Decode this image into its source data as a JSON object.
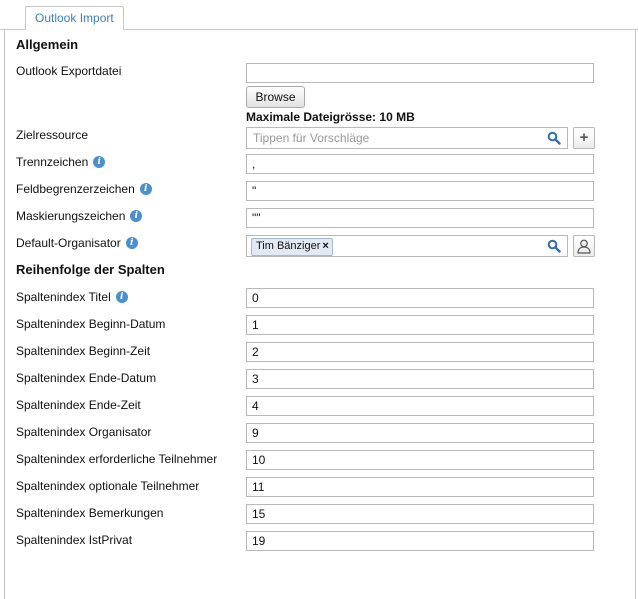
{
  "tab": {
    "label": "Outlook Import"
  },
  "sections": {
    "general": "Allgemein",
    "columns": "Reihenfolge der Spalten"
  },
  "export_file": {
    "label": "Outlook Exportdatei",
    "value": "",
    "browse_label": "Browse",
    "max_size_text": "Maximale Dateigrösse: 10 MB"
  },
  "target_resource": {
    "label": "Zielressource",
    "placeholder": "Tippen für Vorschläge",
    "add_label": "+"
  },
  "separator": {
    "label": "Trennzeichen",
    "value": ","
  },
  "field_delimiter": {
    "label": "Feldbegrenzerzeichen",
    "value": "\""
  },
  "escape_char": {
    "label": "Maskierungszeichen",
    "value": "\"\""
  },
  "default_organizer": {
    "label": "Default-Organisator",
    "chip": "Tim Bänziger",
    "chip_remove": "×"
  },
  "columns": [
    {
      "label": "Spaltenindex Titel",
      "value": "0"
    },
    {
      "label": "Spaltenindex Beginn-Datum",
      "value": "1"
    },
    {
      "label": "Spaltenindex Beginn-Zeit",
      "value": "2"
    },
    {
      "label": "Spaltenindex Ende-Datum",
      "value": "3"
    },
    {
      "label": "Spaltenindex Ende-Zeit",
      "value": "4"
    },
    {
      "label": "Spaltenindex Organisator",
      "value": "9"
    },
    {
      "label": "Spaltenindex erforderliche Teilnehmer",
      "value": "10"
    },
    {
      "label": "Spaltenindex optionale Teilnehmer",
      "value": "11"
    },
    {
      "label": "Spaltenindex Bemerkungen",
      "value": "15"
    },
    {
      "label": "Spaltenindex IstPrivat",
      "value": "19"
    }
  ],
  "icons": {
    "info": "info-icon",
    "search": "search-icon",
    "add": "plus-icon",
    "person": "person-icon"
  },
  "colors": {
    "accent": "#3b7fc4",
    "info_icon": "#4a8fd1",
    "chip_bg": "#e3e9f3"
  }
}
